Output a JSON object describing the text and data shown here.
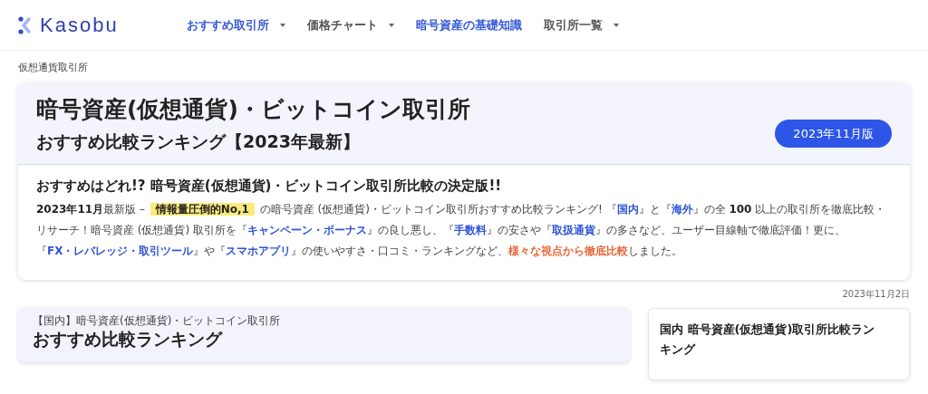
{
  "logo": {
    "text": "Kasobu"
  },
  "nav": [
    {
      "label": "おすすめ取引所",
      "active": true,
      "dropdown": true
    },
    {
      "label": "価格チャート",
      "active": false,
      "dropdown": true
    },
    {
      "label": "暗号資産の基礎知識",
      "active": true,
      "dropdown": false
    },
    {
      "label": "取引所一覧",
      "active": false,
      "dropdown": true
    }
  ],
  "breadcrumb": "仮想通貨取引所",
  "hero": {
    "title": "暗号資産(仮想通貨)・ビットコイン取引所",
    "subtitle": "おすすめ比較ランキング【2023年最新】",
    "badge": "2023年11月版",
    "heading": "おすすめはどれ!? 暗号資産(仮想通貨)・ビットコイン取引所比較の決定版!!",
    "paragraph": [
      {
        "kind": "bold",
        "text": "2023年11月"
      },
      {
        "kind": "plain",
        "text": "最新版 – "
      },
      {
        "kind": "highlight",
        "text": "情報量圧倒的No,1"
      },
      {
        "kind": "plain",
        "text": " の暗号資産 (仮想通貨)・ビットコイン取引所おすすめ比較ランキング! 『"
      },
      {
        "kind": "link",
        "text": "国内"
      },
      {
        "kind": "plain",
        "text": "』と『"
      },
      {
        "kind": "link",
        "text": "海外"
      },
      {
        "kind": "plain",
        "text": "』の全 "
      },
      {
        "kind": "bold",
        "text": "100"
      },
      {
        "kind": "plain",
        "text": " 以上の取引所を徹底比較・リサーチ！暗号資産 (仮想通貨) 取引所を『"
      },
      {
        "kind": "link",
        "text": "キャンペーン・ボーナス"
      },
      {
        "kind": "plain",
        "text": "』の良し悪し、『"
      },
      {
        "kind": "link",
        "text": "手数料"
      },
      {
        "kind": "plain",
        "text": "』の安さや『"
      },
      {
        "kind": "link",
        "text": "取扱通貨"
      },
      {
        "kind": "plain",
        "text": "』の多さなど、ユーザー目線軸で徹底評価！更に、『"
      },
      {
        "kind": "link",
        "text": "FX・レバレッジ・取引ツール"
      },
      {
        "kind": "plain",
        "text": "』や『"
      },
      {
        "kind": "link",
        "text": "スマホアプリ"
      },
      {
        "kind": "plain",
        "text": "』の使いやすさ・口コミ・ランキングなど、"
      },
      {
        "kind": "accent",
        "text": "様々な視点から徹底比較"
      },
      {
        "kind": "plain",
        "text": "しました。"
      }
    ]
  },
  "date": "2023年11月2日",
  "ranking_card": {
    "kicker": "【国内】暗号資産(仮想通貨)・ビットコイン取引所",
    "title": "おすすめ比較ランキング"
  },
  "side_card": {
    "title": "国内 暗号資産(仮想通貨)取引所比較ランキング"
  }
}
